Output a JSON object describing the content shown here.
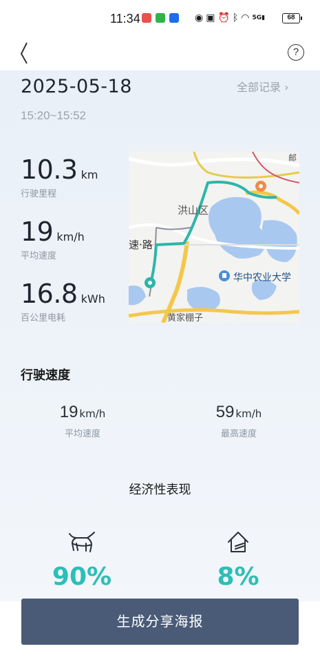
{
  "status_bar": {
    "time": "11:34",
    "signal_label": "5G",
    "battery": "68"
  },
  "nav": {
    "back_icon": "chevron-left-icon",
    "help_label": "?"
  },
  "trip": {
    "date": "2025-05-18",
    "all_records": "全部记录 ›",
    "time_range": "15:20~15:52"
  },
  "stats": [
    {
      "value": "10.3",
      "unit": "km",
      "label": "行驶里程"
    },
    {
      "value": "19",
      "unit": "km/h",
      "label": "平均速度"
    },
    {
      "value": "16.8",
      "unit": "kWh",
      "label": "百公里电耗"
    }
  ],
  "map": {
    "district": "洪山区",
    "road": "速·路",
    "university": "华中农业大学",
    "bottom_label": "黄家棚子",
    "top_right_label": "邮"
  },
  "speed_section": {
    "title": "行驶速度",
    "avg": {
      "value": "19",
      "unit": "km/h",
      "label": "平均速度"
    },
    "max": {
      "value": "59",
      "unit": "km/h",
      "label": "最高速度"
    }
  },
  "economy": {
    "title": "经济性表现",
    "items": [
      {
        "icon": "ox-icon",
        "value": "90%"
      },
      {
        "icon": "house-icon",
        "value": "8%"
      }
    ]
  },
  "share_button": "生成分享海报",
  "colors": {
    "accent": "#2bbfb8",
    "button": "#4a5b78",
    "route": "#2cb6a9"
  }
}
